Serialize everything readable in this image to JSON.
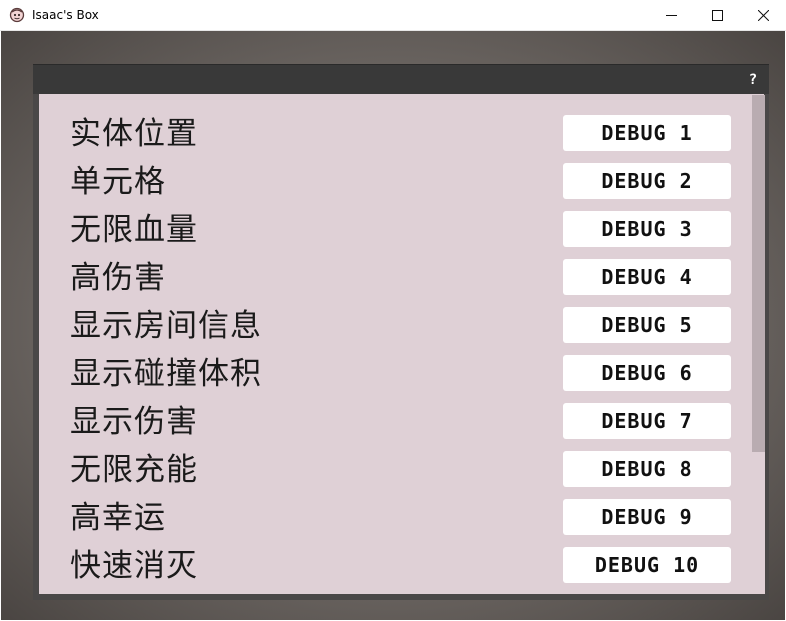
{
  "window": {
    "title": "Isaac's Box",
    "controls": {
      "minimize": "—",
      "maximize": "☐",
      "close": "✕"
    }
  },
  "panel": {
    "help_label": "?"
  },
  "items": [
    {
      "label": "实体位置",
      "button": "DEBUG 1"
    },
    {
      "label": "单元格",
      "button": "DEBUG 2"
    },
    {
      "label": "无限血量",
      "button": "DEBUG 3"
    },
    {
      "label": "高伤害",
      "button": "DEBUG 4"
    },
    {
      "label": "显示房间信息",
      "button": "DEBUG 5"
    },
    {
      "label": "显示碰撞体积",
      "button": "DEBUG 6"
    },
    {
      "label": "显示伤害",
      "button": "DEBUG 7"
    },
    {
      "label": "无限充能",
      "button": "DEBUG 8"
    },
    {
      "label": "高幸运",
      "button": "DEBUG 9"
    },
    {
      "label": "快速消灭",
      "button": "DEBUG 10"
    }
  ],
  "colors": {
    "panel_bg": "#dfd0d6",
    "header_bg": "#393939",
    "button_bg": "#ffffff"
  }
}
